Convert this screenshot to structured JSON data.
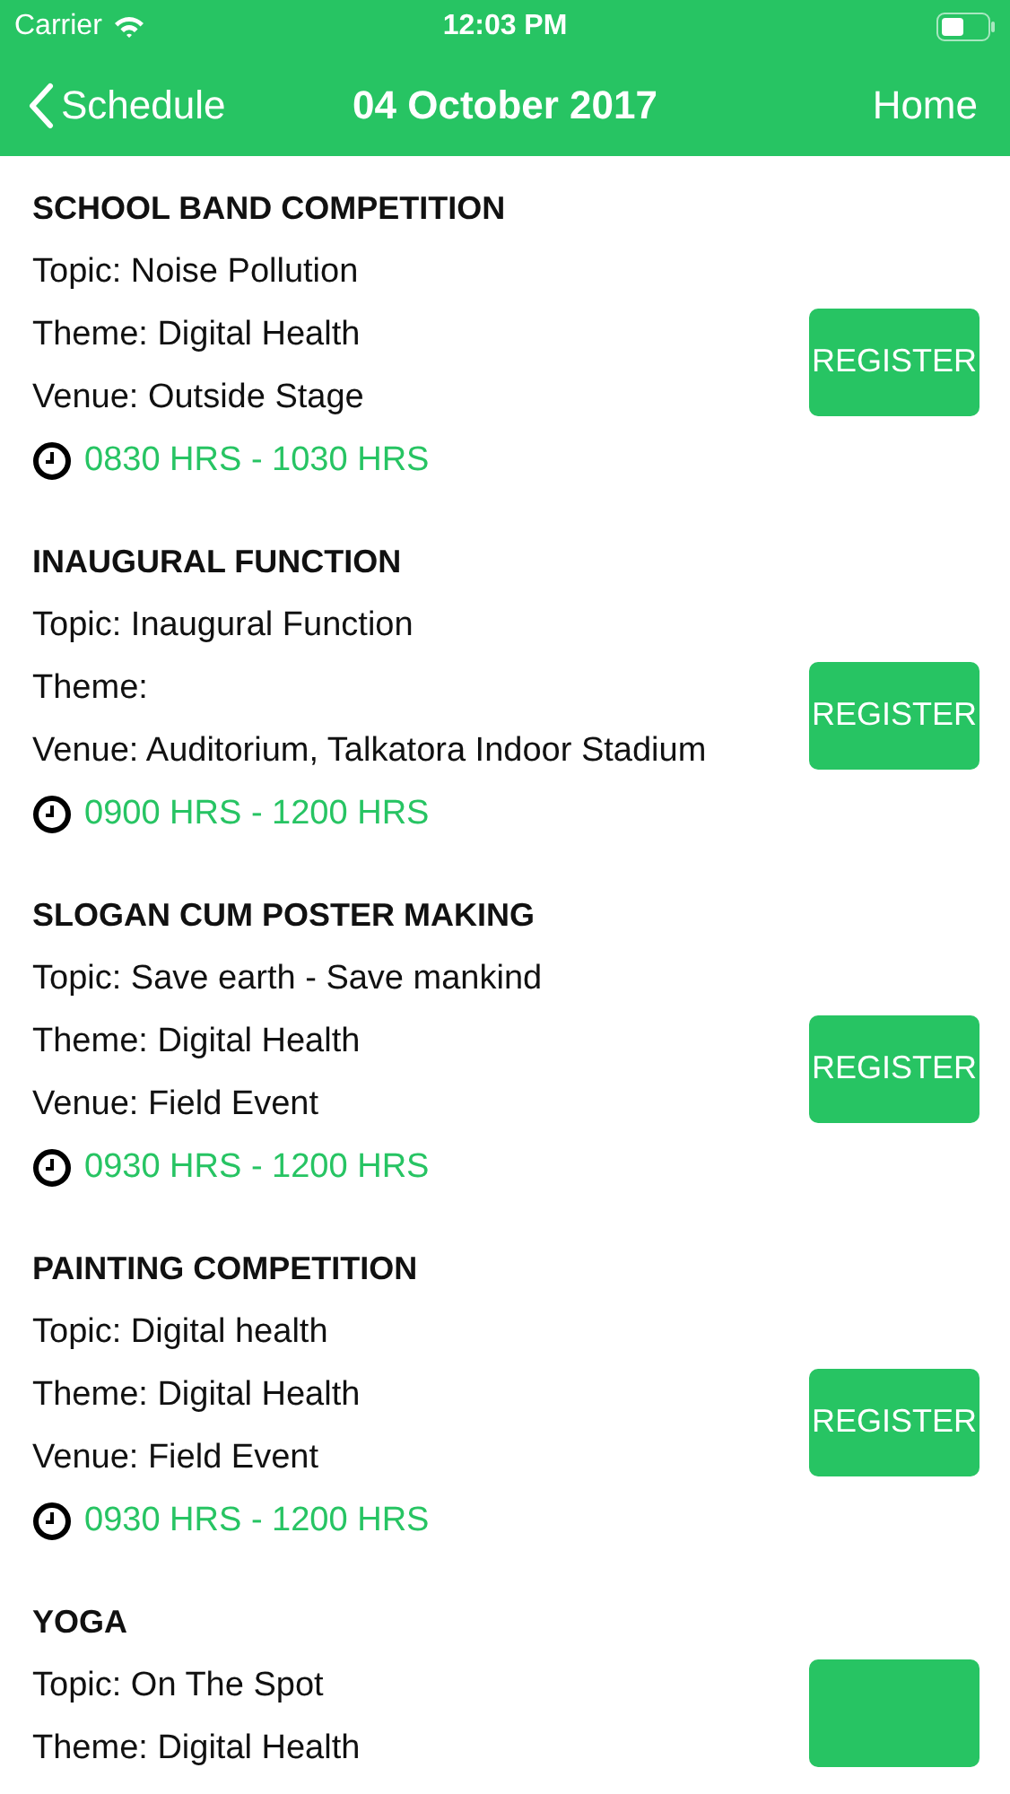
{
  "status_bar": {
    "carrier": "Carrier",
    "time": "12:03 PM"
  },
  "nav": {
    "back": "Schedule",
    "title": "04 October 2017",
    "right": "Home"
  },
  "events": [
    {
      "title": "SCHOOL BAND COMPETITION",
      "lines": [
        "Topic: Noise Pollution",
        "Theme: Digital Health",
        "Venue: Outside Stage"
      ],
      "time": "0830 HRS - 1030 HRS",
      "button": "REGISTER"
    },
    {
      "title": "INAUGURAL FUNCTION",
      "lines": [
        "Topic: Inaugural Function",
        "Theme:",
        "Venue: Auditorium, Talkatora Indoor Stadium"
      ],
      "time": "0900 HRS - 1200 HRS",
      "button": "REGISTER"
    },
    {
      "title": "SLOGAN CUM POSTER MAKING",
      "lines": [
        "Topic: Save earth - Save mankind",
        "Theme: Digital Health",
        "Venue: Field Event"
      ],
      "time": "0930 HRS - 1200 HRS",
      "button": "REGISTER"
    },
    {
      "title": "PAINTING COMPETITION",
      "lines": [
        "Topic: Digital health",
        "Theme: Digital Health",
        "Venue: Field Event"
      ],
      "time": "0930 HRS - 1200 HRS",
      "button": "REGISTER"
    },
    {
      "title": "YOGA",
      "lines": [
        "Topic: On The Spot",
        "Theme: Digital Health"
      ]
    }
  ]
}
